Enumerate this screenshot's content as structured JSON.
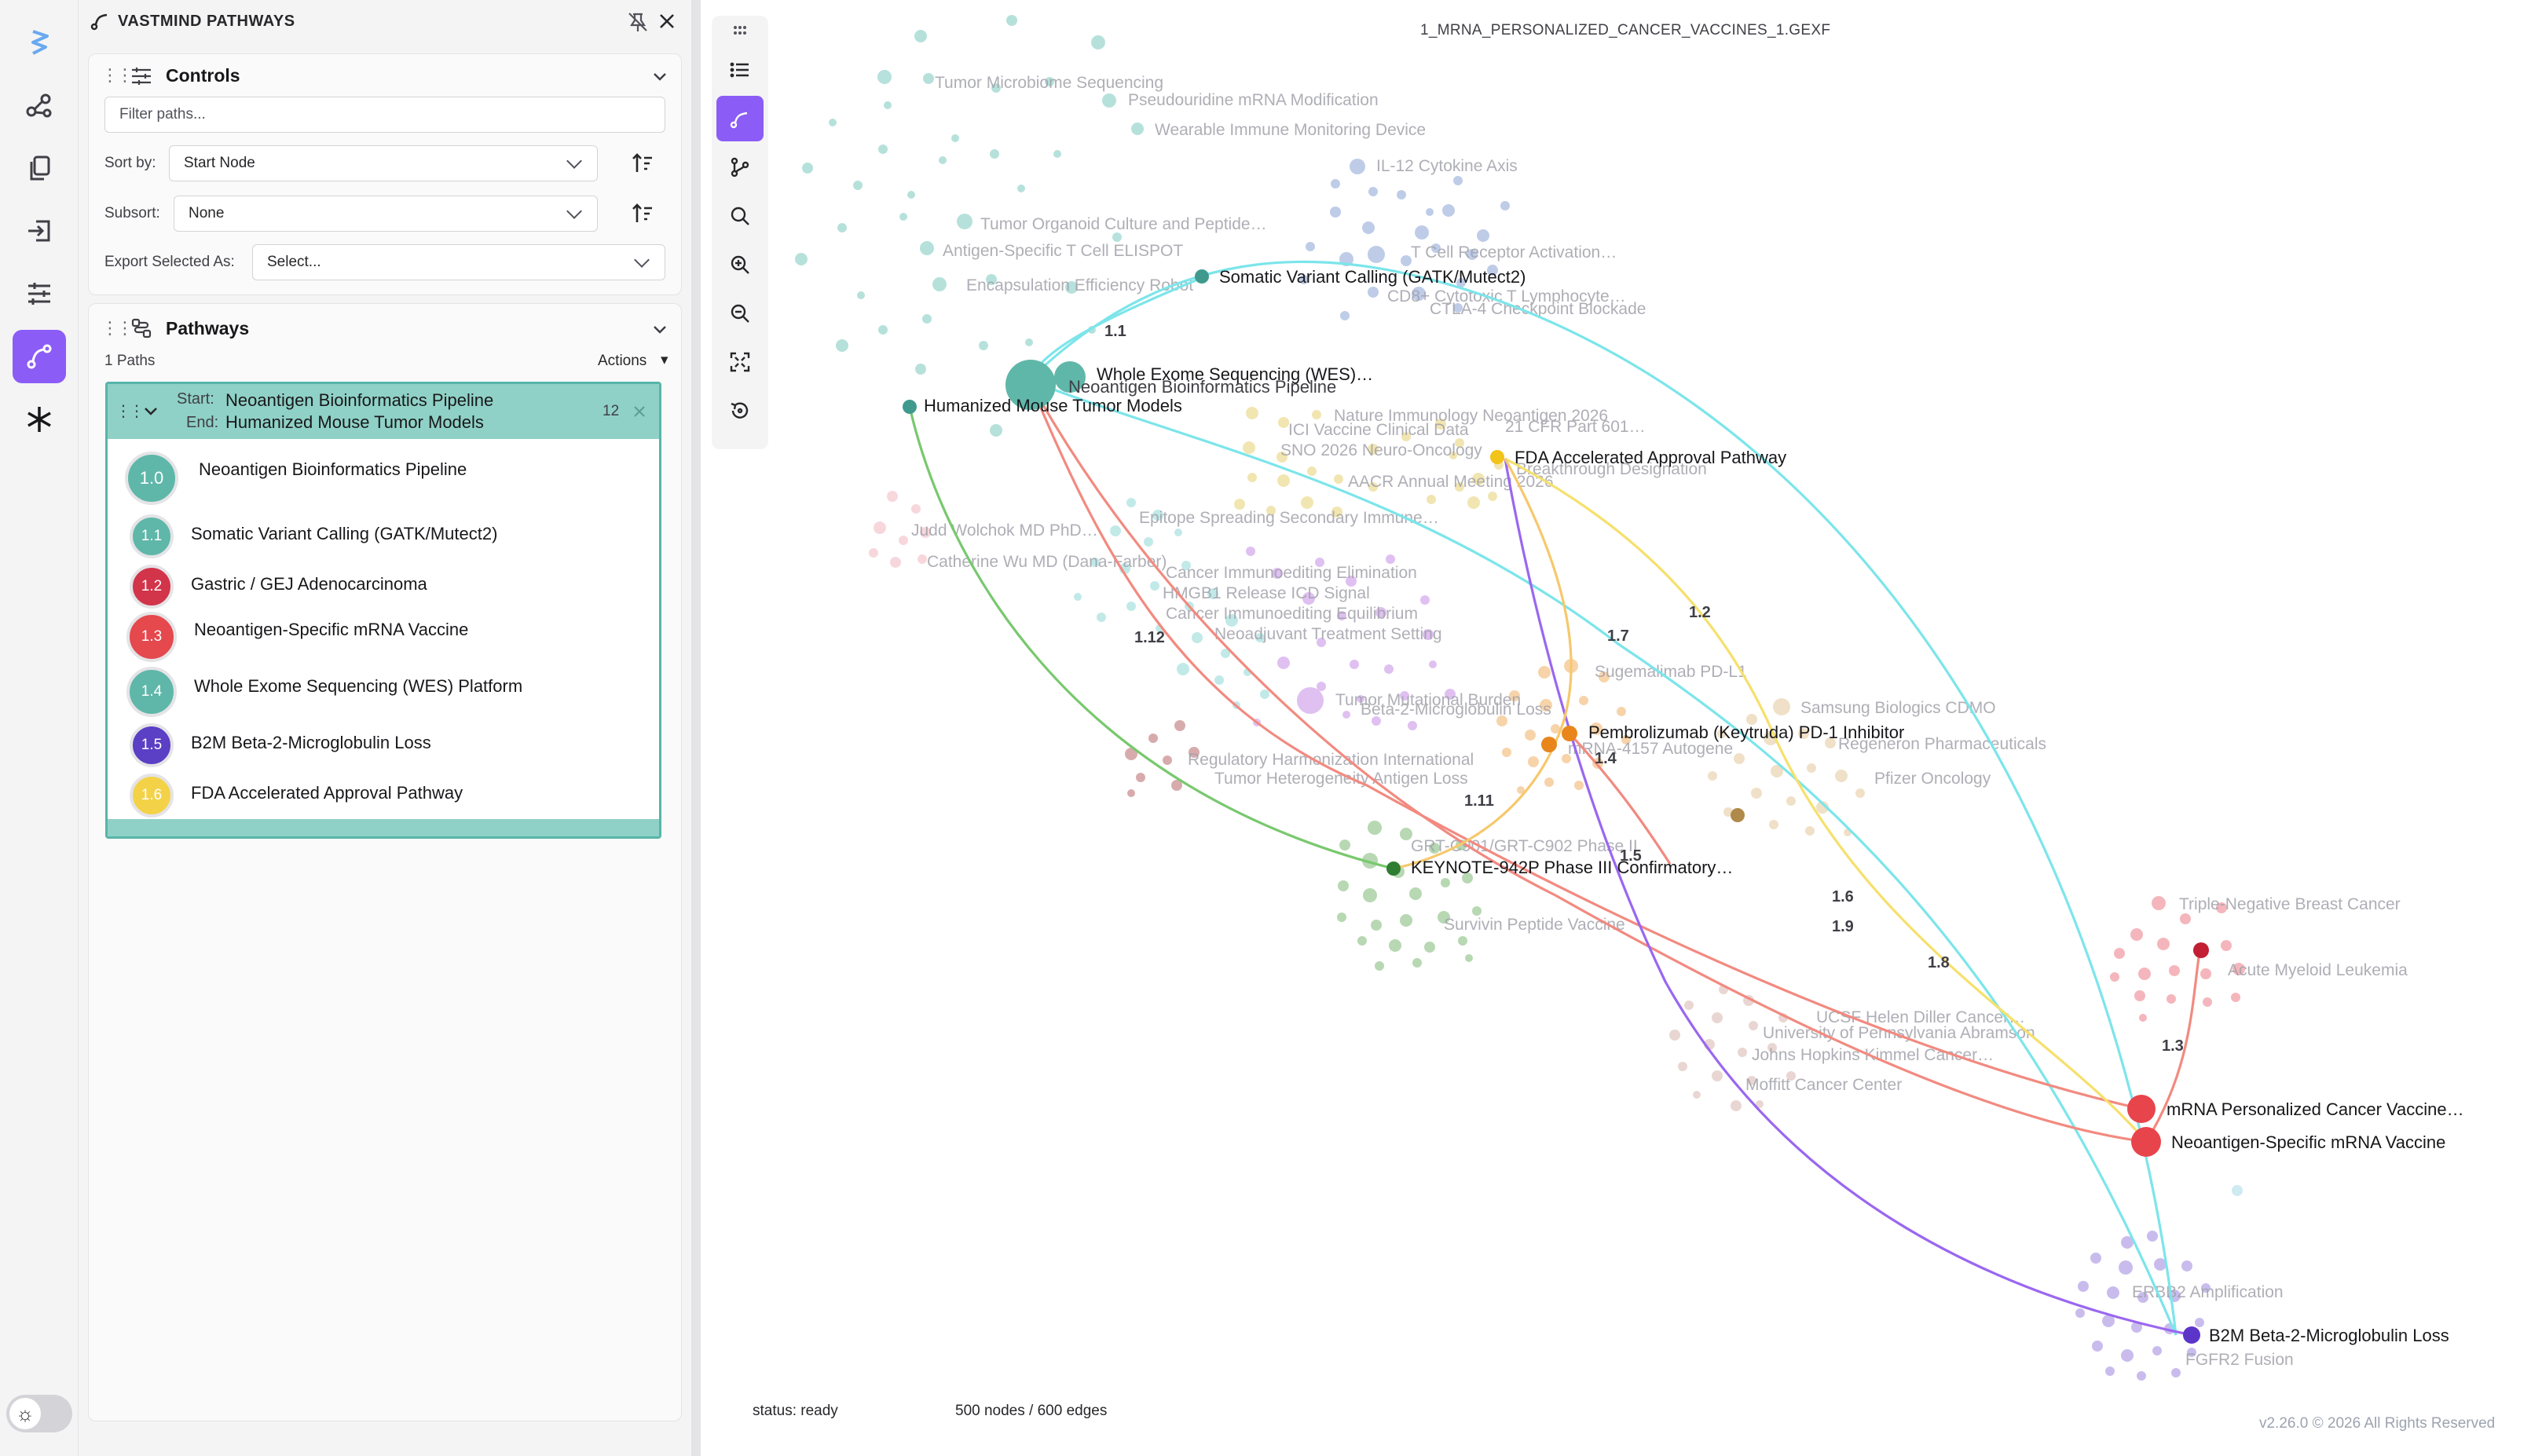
{
  "app": {
    "title": "VASTMIND PATHWAYS"
  },
  "rail": {
    "items": [
      {
        "icon": "logo-bolt-icon"
      },
      {
        "icon": "graph-icon"
      },
      {
        "icon": "copy-icon"
      },
      {
        "icon": "import-icon"
      },
      {
        "icon": "sliders-icon"
      },
      {
        "icon": "pathway-icon",
        "active": true
      },
      {
        "icon": "asterisk-icon"
      }
    ],
    "theme_toggle_icon": "☼"
  },
  "controls": {
    "title": "Controls",
    "filter_placeholder": "Filter paths...",
    "sort_by_label": "Sort by:",
    "sort_by_value": "Start Node",
    "subsort_label": "Subsort:",
    "subsort_value": "None",
    "export_label": "Export Selected As:",
    "export_value": "Select..."
  },
  "pathways": {
    "title": "Pathways",
    "count_text": "1 Paths",
    "actions_label": "Actions",
    "path": {
      "start_prefix": "Start:",
      "start": "Neoantigen Bioinformatics Pipeline",
      "end_prefix": "End:",
      "end": "Humanized Mouse Tumor Models",
      "count": "12",
      "steps": [
        {
          "num": "1.0",
          "label": "Neoantigen Bioinformatics Pipeline",
          "color": "#5fb7a9"
        },
        {
          "num": "1.1",
          "label": "Somatic Variant Calling (GATK/Mutect2)",
          "color": "#5fb7a9"
        },
        {
          "num": "1.2",
          "label": "Gastric / GEJ Adenocarcinoma",
          "color": "#d2344a"
        },
        {
          "num": "1.3",
          "label": "Neoantigen-Specific mRNA Vaccine",
          "color": "#e5484d"
        },
        {
          "num": "1.4",
          "label": "Whole Exome Sequencing (WES) Platform",
          "color": "#5fb7a9"
        },
        {
          "num": "1.5",
          "label": "B2M Beta-2-Microglobulin Loss",
          "color": "#5b3fc4"
        },
        {
          "num": "1.6",
          "label": "FDA Accelerated Approval Pathway",
          "color": "#f4d248"
        }
      ]
    }
  },
  "graph": {
    "file_title": "1_MRNA_PERSONALIZED_CANCER_VACCINES_1.GEXF",
    "status": "status: ready",
    "counts": "500 nodes / 600 edges",
    "version": "v2.26.0 © 2026 All Rights Reserved",
    "toolbar": [
      "drag-handle-icon",
      "list-icon",
      "pathway-icon",
      "branch-icon",
      "search-icon",
      "zoom-in-icon",
      "zoom-out-icon",
      "fit-screen-icon",
      "reset-icon"
    ],
    "main_labels": [
      "Somatic Variant Calling (GATK/Mutect2)",
      "Whole Exome Sequencing (WES)…",
      "Neoantigen Bioinformatics Pipeline",
      "Humanized Mouse Tumor Models",
      "FDA Accelerated Approval Pathway",
      "Pembrolizumab (Keytruda) PD-1 Inhibitor",
      "KEYNOTE-942P Phase III Confirmatory…",
      "mRNA Personalized Cancer Vaccine…",
      "Neoantigen-Specific mRNA Vaccine",
      "B2M Beta-2-Microglobulin Loss"
    ],
    "faded_labels": [
      "Tumor Microbiome Sequencing",
      "Pseudouridine mRNA Modification",
      "Wearable Immune Monitoring Device",
      "IL-12 Cytokine Axis",
      "Tumor Organoid Culture and Peptide…",
      "Antigen-Specific T Cell ELISPOT",
      "T Cell Receptor Activation…",
      "Encapsulation Efficiency Robot",
      "CD8+ Cytotoxic T Lymphocyte…",
      "CTLA-4 Checkpoint Blockade",
      "Nature Immunology Neoantigen 2026",
      "ICI Vaccine Clinical Data",
      "21 CFR Part 601…",
      "SNO 2026 Neuro-Oncology",
      "AACR Annual Meeting 2026",
      "Breakthrough Designation",
      "Judd Wolchok MD PhD…",
      "Catherine Wu MD (Dana-Farber)",
      "Epitope Spreading Secondary Immune…",
      "Cancer Immunoediting Elimination",
      "HMGB1 Release ICD Signal",
      "Cancer Immunoediting Equilibrium",
      "Neoadjuvant Treatment Setting",
      "Tumor Mutational Burden",
      "Beta-2-Microglobulin Loss",
      "Sugemalimab PD-L1",
      "Samsung Biologics CDMO",
      "Regulatory Harmonization International",
      "Tumor Heterogeneity Antigen Loss",
      "mRNA-4157 Autogene",
      "Regeneron Pharmaceuticals",
      "Pfizer Oncology",
      "GRT-C901/GRT-C902 Phase II",
      "Survivin Peptide Vaccine",
      "Triple-Negative Breast Cancer",
      "Acute Myeloid Leukemia",
      "UCSF Helen Diller Cancer…",
      "University of Pennsylvania Abramson",
      "Johns Hopkins Kimmel Cancer…",
      "Moffitt Cancer Center",
      "ERBB2 Amplification",
      "FGFR2 Fusion"
    ],
    "edge_labels": [
      "1.1",
      "1.2",
      "1.3",
      "1.4",
      "1.5",
      "1.6",
      "1.7",
      "1.8",
      "1.9",
      "1.11",
      "1.12"
    ]
  }
}
